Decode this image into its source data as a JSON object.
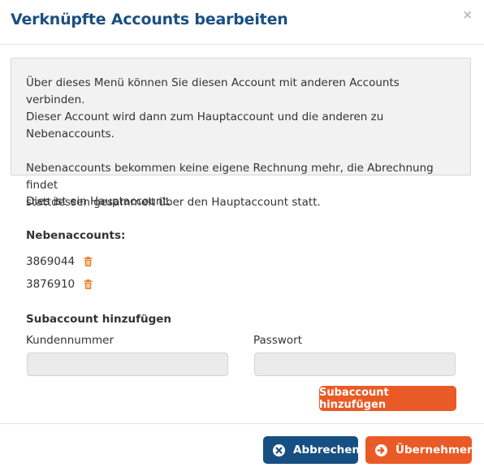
{
  "dialog": {
    "title": "Verknüpfte Accounts bearbeiten",
    "close_label": "×"
  },
  "info": {
    "paragraph1_line1": "Über dieses Menü können Sie diesen Account mit anderen Accounts verbinden.",
    "paragraph1_line2": "Dieser Account wird dann zum Hauptaccount und die anderen zu Nebenaccounts.",
    "paragraph2_line1": "Nebenaccounts bekommen keine eigene Rechnung mehr, die Abrechnung findet",
    "paragraph2_line2": "stattdessen gesammelt über den Hauptaccount statt."
  },
  "status_text": "Dies ist ein Hauptaccount.",
  "subaccounts": {
    "heading": "Nebenaccounts:",
    "items": [
      {
        "number": "3869044",
        "icon": "trash-icon"
      },
      {
        "number": "3876910",
        "icon": "trash-icon"
      }
    ]
  },
  "add_form": {
    "heading": "Subaccount hinzufügen",
    "customer_label": "Kundennummer",
    "customer_value": "",
    "password_label": "Passwort",
    "password_value": "",
    "submit_label": "Subaccount hinzufügen"
  },
  "footer": {
    "cancel_label": "Abbrechen",
    "cancel_icon": "x-circle-icon",
    "apply_label": "Übernehmen",
    "apply_icon": "arrow-right-circle-icon"
  },
  "colors": {
    "title": "#1b4f82",
    "primary_orange": "#ea5a26",
    "primary_blue": "#174f82",
    "trash": "#e8802b"
  }
}
